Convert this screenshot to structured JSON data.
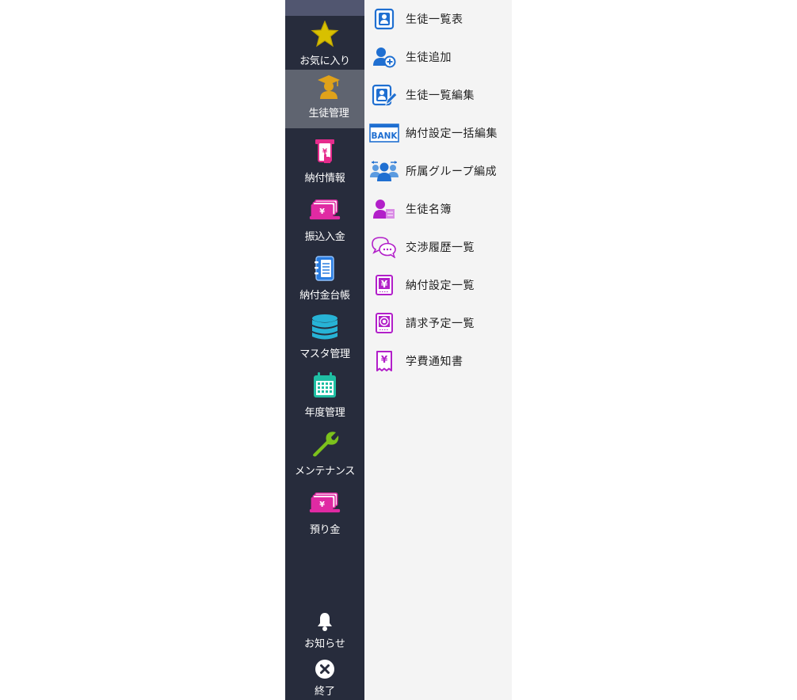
{
  "sidebar": {
    "items": [
      {
        "label": "お気に入り",
        "icon": "star-icon"
      },
      {
        "label": "生徒管理",
        "icon": "student-graduate-icon"
      },
      {
        "label": "納付情報",
        "icon": "payment-terminal-icon"
      },
      {
        "label": "振込入金",
        "icon": "yen-money-icon"
      },
      {
        "label": "納付金台帳",
        "icon": "ledger-notebook-icon"
      },
      {
        "label": "マスタ管理",
        "icon": "database-icon"
      },
      {
        "label": "年度管理",
        "icon": "calendar-icon"
      },
      {
        "label": "メンテナンス",
        "icon": "wrench-icon"
      },
      {
        "label": "預り金",
        "icon": "yen-money-icon"
      }
    ],
    "active_index": 1,
    "footer": [
      {
        "label": "お知らせ",
        "icon": "bell-icon"
      },
      {
        "label": "終了",
        "icon": "close-circle-icon"
      }
    ]
  },
  "submenu": {
    "items": [
      {
        "label": "生徒一覧表",
        "icon": "student-card-icon"
      },
      {
        "label": "生徒追加",
        "icon": "add-user-icon"
      },
      {
        "label": "生徒一覧編集",
        "icon": "edit-student-card-icon"
      },
      {
        "label": "納付設定一括編集",
        "icon": "bank-icon",
        "icon_text": "BANK"
      },
      {
        "label": "所属グループ編成",
        "icon": "group-users-icon"
      },
      {
        "label": "生徒名簿",
        "icon": "student-roster-icon"
      },
      {
        "label": "交渉履歴一覧",
        "icon": "chat-bubbles-icon"
      },
      {
        "label": "納付設定一覧",
        "icon": "yen-document-icon"
      },
      {
        "label": "請求予定一覧",
        "icon": "coin-document-icon"
      },
      {
        "label": "学費通知書",
        "icon": "yen-receipt-icon"
      }
    ]
  },
  "colors": {
    "sidebar_bg": "#272c3c",
    "sidebar_top": "#515670",
    "active_bg": "#5f6470",
    "submenu_bg": "#f4f4f4",
    "blue_icon": "#1f6fd1",
    "purple_icon": "#b21fc9"
  }
}
